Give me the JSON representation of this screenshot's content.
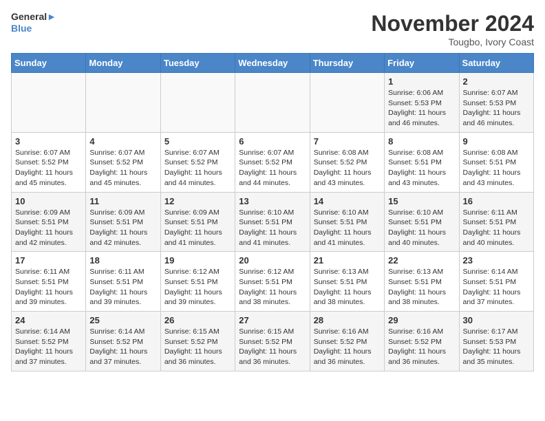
{
  "header": {
    "logo_line1": "General",
    "logo_line2": "Blue",
    "month_title": "November 2024",
    "location": "Tougbo, Ivory Coast"
  },
  "weekdays": [
    "Sunday",
    "Monday",
    "Tuesday",
    "Wednesday",
    "Thursday",
    "Friday",
    "Saturday"
  ],
  "rows": [
    [
      {
        "day": "",
        "info": ""
      },
      {
        "day": "",
        "info": ""
      },
      {
        "day": "",
        "info": ""
      },
      {
        "day": "",
        "info": ""
      },
      {
        "day": "",
        "info": ""
      },
      {
        "day": "1",
        "info": "Sunrise: 6:06 AM\nSunset: 5:53 PM\nDaylight: 11 hours\nand 46 minutes."
      },
      {
        "day": "2",
        "info": "Sunrise: 6:07 AM\nSunset: 5:53 PM\nDaylight: 11 hours\nand 46 minutes."
      }
    ],
    [
      {
        "day": "3",
        "info": "Sunrise: 6:07 AM\nSunset: 5:52 PM\nDaylight: 11 hours\nand 45 minutes."
      },
      {
        "day": "4",
        "info": "Sunrise: 6:07 AM\nSunset: 5:52 PM\nDaylight: 11 hours\nand 45 minutes."
      },
      {
        "day": "5",
        "info": "Sunrise: 6:07 AM\nSunset: 5:52 PM\nDaylight: 11 hours\nand 44 minutes."
      },
      {
        "day": "6",
        "info": "Sunrise: 6:07 AM\nSunset: 5:52 PM\nDaylight: 11 hours\nand 44 minutes."
      },
      {
        "day": "7",
        "info": "Sunrise: 6:08 AM\nSunset: 5:52 PM\nDaylight: 11 hours\nand 43 minutes."
      },
      {
        "day": "8",
        "info": "Sunrise: 6:08 AM\nSunset: 5:51 PM\nDaylight: 11 hours\nand 43 minutes."
      },
      {
        "day": "9",
        "info": "Sunrise: 6:08 AM\nSunset: 5:51 PM\nDaylight: 11 hours\nand 43 minutes."
      }
    ],
    [
      {
        "day": "10",
        "info": "Sunrise: 6:09 AM\nSunset: 5:51 PM\nDaylight: 11 hours\nand 42 minutes."
      },
      {
        "day": "11",
        "info": "Sunrise: 6:09 AM\nSunset: 5:51 PM\nDaylight: 11 hours\nand 42 minutes."
      },
      {
        "day": "12",
        "info": "Sunrise: 6:09 AM\nSunset: 5:51 PM\nDaylight: 11 hours\nand 41 minutes."
      },
      {
        "day": "13",
        "info": "Sunrise: 6:10 AM\nSunset: 5:51 PM\nDaylight: 11 hours\nand 41 minutes."
      },
      {
        "day": "14",
        "info": "Sunrise: 6:10 AM\nSunset: 5:51 PM\nDaylight: 11 hours\nand 41 minutes."
      },
      {
        "day": "15",
        "info": "Sunrise: 6:10 AM\nSunset: 5:51 PM\nDaylight: 11 hours\nand 40 minutes."
      },
      {
        "day": "16",
        "info": "Sunrise: 6:11 AM\nSunset: 5:51 PM\nDaylight: 11 hours\nand 40 minutes."
      }
    ],
    [
      {
        "day": "17",
        "info": "Sunrise: 6:11 AM\nSunset: 5:51 PM\nDaylight: 11 hours\nand 39 minutes."
      },
      {
        "day": "18",
        "info": "Sunrise: 6:11 AM\nSunset: 5:51 PM\nDaylight: 11 hours\nand 39 minutes."
      },
      {
        "day": "19",
        "info": "Sunrise: 6:12 AM\nSunset: 5:51 PM\nDaylight: 11 hours\nand 39 minutes."
      },
      {
        "day": "20",
        "info": "Sunrise: 6:12 AM\nSunset: 5:51 PM\nDaylight: 11 hours\nand 38 minutes."
      },
      {
        "day": "21",
        "info": "Sunrise: 6:13 AM\nSunset: 5:51 PM\nDaylight: 11 hours\nand 38 minutes."
      },
      {
        "day": "22",
        "info": "Sunrise: 6:13 AM\nSunset: 5:51 PM\nDaylight: 11 hours\nand 38 minutes."
      },
      {
        "day": "23",
        "info": "Sunrise: 6:14 AM\nSunset: 5:51 PM\nDaylight: 11 hours\nand 37 minutes."
      }
    ],
    [
      {
        "day": "24",
        "info": "Sunrise: 6:14 AM\nSunset: 5:52 PM\nDaylight: 11 hours\nand 37 minutes."
      },
      {
        "day": "25",
        "info": "Sunrise: 6:14 AM\nSunset: 5:52 PM\nDaylight: 11 hours\nand 37 minutes."
      },
      {
        "day": "26",
        "info": "Sunrise: 6:15 AM\nSunset: 5:52 PM\nDaylight: 11 hours\nand 36 minutes."
      },
      {
        "day": "27",
        "info": "Sunrise: 6:15 AM\nSunset: 5:52 PM\nDaylight: 11 hours\nand 36 minutes."
      },
      {
        "day": "28",
        "info": "Sunrise: 6:16 AM\nSunset: 5:52 PM\nDaylight: 11 hours\nand 36 minutes."
      },
      {
        "day": "29",
        "info": "Sunrise: 6:16 AM\nSunset: 5:52 PM\nDaylight: 11 hours\nand 36 minutes."
      },
      {
        "day": "30",
        "info": "Sunrise: 6:17 AM\nSunset: 5:53 PM\nDaylight: 11 hours\nand 35 minutes."
      }
    ]
  ]
}
